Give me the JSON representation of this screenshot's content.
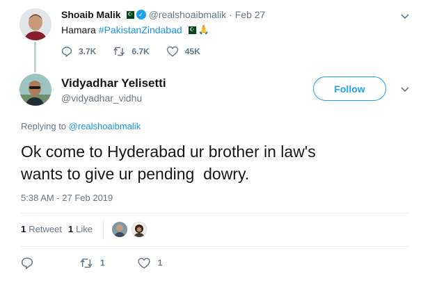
{
  "parent_tweet": {
    "author_name": "Shoaib Malik",
    "handle": "@realshoaibmalik",
    "separator": "·",
    "date": "Feb 27",
    "text": "Hamara",
    "hashtag": "#PakistanZindabad",
    "replies": "3.7K",
    "retweets": "6.7K",
    "likes": "45K"
  },
  "main_tweet": {
    "author_name": "Vidyadhar Yelisetti",
    "handle": "@vidyadhar_vidhu",
    "follow_label": "Follow",
    "replying_prefix": "Replying to",
    "replying_to": "@realshoaibmalik",
    "body": "Ok come to Hyderabad ur brother in law's\nwants to give ur pending  dowry.",
    "timestamp": "5:38 AM - 27 Feb 2019",
    "retweet_count": "1",
    "retweet_label": "Retweet",
    "like_count": "1",
    "like_label": "Like",
    "action_retweets": "1",
    "action_likes": "1"
  },
  "colors": {
    "accent": "#1da1f2",
    "link": "#1b95e0",
    "muted": "#657786"
  },
  "icons": [
    "chevron-down-icon",
    "verified-badge-icon",
    "pakistan-flag-icon",
    "folded-hands-icon",
    "reply-icon",
    "retweet-icon",
    "like-icon"
  ]
}
